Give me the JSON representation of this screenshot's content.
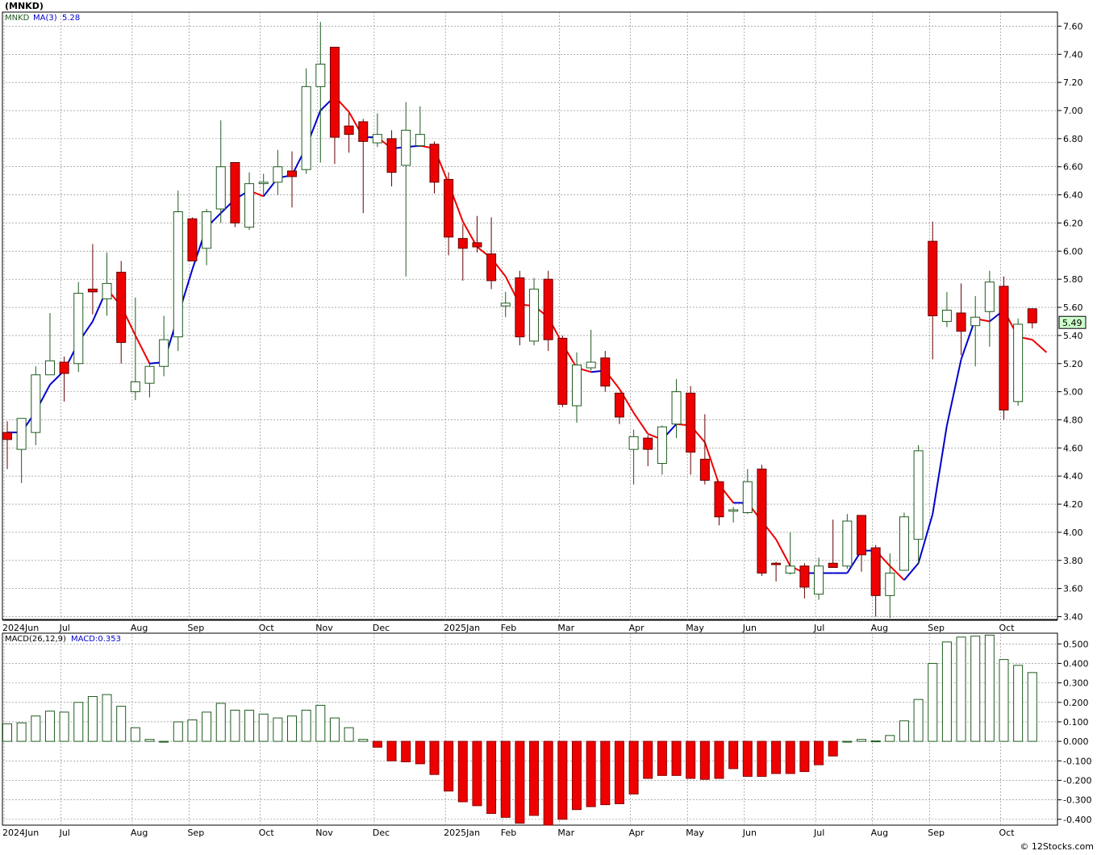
{
  "header": {
    "symbol_title": "(MNKD)",
    "footer": "© 12Stocks.com"
  },
  "colors": {
    "grid": "#7f7f7f",
    "up_edge": "#1f5c1f",
    "down_fill": "#ee0000",
    "down_edge": "#660000",
    "ma_up": "#0000cc",
    "ma_down": "#ee0000",
    "macd_pos_edge": "#1f5c1f",
    "macd_neg_fill": "#ee0000",
    "symbol_text": "#1f5c1f",
    "ma_text": "#0000cc",
    "last_label_bg": "#ccffcc"
  },
  "chart_data": [
    {
      "type": "candlestick",
      "legend": {
        "symbol": "MNKD",
        "ma_label": "MA(3)",
        "ma_value": "5.28"
      },
      "last_price_label": "5.49",
      "last_price": 5.49,
      "ylim": [
        3.38,
        7.7
      ],
      "y_ticks": [
        "7.60",
        "7.40",
        "7.20",
        "7.00",
        "6.80",
        "6.60",
        "6.40",
        "6.20",
        "6.00",
        "5.80",
        "5.60",
        "5.40",
        "5.20",
        "5.00",
        "4.80",
        "4.60",
        "4.40",
        "4.20",
        "4.00",
        "3.80",
        "3.60",
        "3.40"
      ],
      "x_labels": [
        {
          "label": "2024Jun",
          "index": 0
        },
        {
          "label": "Jul",
          "index": 4
        },
        {
          "label": "Aug",
          "index": 9
        },
        {
          "label": "Sep",
          "index": 13
        },
        {
          "label": "Oct",
          "index": 18
        },
        {
          "label": "Nov",
          "index": 22
        },
        {
          "label": "Dec",
          "index": 26
        },
        {
          "label": "2025Jan",
          "index": 31
        },
        {
          "label": "Feb",
          "index": 35
        },
        {
          "label": "Mar",
          "index": 39
        },
        {
          "label": "Apr",
          "index": 44
        },
        {
          "label": "May",
          "index": 48
        },
        {
          "label": "Jun",
          "index": 52
        },
        {
          "label": "Jul",
          "index": 57
        },
        {
          "label": "Aug",
          "index": 61
        },
        {
          "label": "Sep",
          "index": 65
        },
        {
          "label": "Oct",
          "index": 70
        }
      ],
      "candles": [
        {
          "o": 4.71,
          "h": 4.79,
          "l": 4.45,
          "c": 4.66
        },
        {
          "o": 4.59,
          "h": 4.81,
          "l": 4.35,
          "c": 4.81
        },
        {
          "o": 4.71,
          "h": 5.18,
          "l": 4.62,
          "c": 5.12
        },
        {
          "o": 5.12,
          "h": 5.56,
          "l": 5.12,
          "c": 5.22
        },
        {
          "o": 5.21,
          "h": 5.25,
          "l": 4.93,
          "c": 5.13
        },
        {
          "o": 5.2,
          "h": 5.78,
          "l": 5.14,
          "c": 5.7
        },
        {
          "o": 5.73,
          "h": 6.05,
          "l": 5.55,
          "c": 5.71
        },
        {
          "o": 5.66,
          "h": 5.99,
          "l": 5.54,
          "c": 5.77
        },
        {
          "o": 5.85,
          "h": 5.93,
          "l": 5.2,
          "c": 5.35
        },
        {
          "o": 5.0,
          "h": 5.67,
          "l": 4.94,
          "c": 5.07
        },
        {
          "o": 5.06,
          "h": 5.2,
          "l": 4.96,
          "c": 5.18
        },
        {
          "o": 5.18,
          "h": 5.54,
          "l": 5.11,
          "c": 5.37
        },
        {
          "o": 5.39,
          "h": 6.43,
          "l": 5.29,
          "c": 6.28
        },
        {
          "o": 6.23,
          "h": 6.24,
          "l": 5.95,
          "c": 5.93
        },
        {
          "o": 6.02,
          "h": 6.3,
          "l": 5.9,
          "c": 6.28
        },
        {
          "o": 6.3,
          "h": 6.93,
          "l": 6.2,
          "c": 6.6
        },
        {
          "o": 6.63,
          "h": 6.63,
          "l": 6.17,
          "c": 6.2
        },
        {
          "o": 6.17,
          "h": 6.56,
          "l": 6.15,
          "c": 6.48
        },
        {
          "o": 6.48,
          "h": 6.55,
          "l": 6.4,
          "c": 6.49
        },
        {
          "o": 6.49,
          "h": 6.72,
          "l": 6.4,
          "c": 6.6
        },
        {
          "o": 6.57,
          "h": 6.71,
          "l": 6.31,
          "c": 6.53
        },
        {
          "o": 6.58,
          "h": 7.3,
          "l": 6.55,
          "c": 7.17
        },
        {
          "o": 7.17,
          "h": 7.63,
          "l": 6.63,
          "c": 7.33
        },
        {
          "o": 7.45,
          "h": 7.45,
          "l": 6.62,
          "c": 6.81
        },
        {
          "o": 6.89,
          "h": 6.98,
          "l": 6.7,
          "c": 6.83
        },
        {
          "o": 6.92,
          "h": 6.94,
          "l": 6.27,
          "c": 6.78
        },
        {
          "o": 6.77,
          "h": 6.98,
          "l": 6.74,
          "c": 6.83
        },
        {
          "o": 6.8,
          "h": 6.86,
          "l": 6.46,
          "c": 6.56
        },
        {
          "o": 6.61,
          "h": 7.06,
          "l": 5.82,
          "c": 6.86
        },
        {
          "o": 6.75,
          "h": 7.03,
          "l": 6.74,
          "c": 6.83
        },
        {
          "o": 6.76,
          "h": 6.78,
          "l": 6.41,
          "c": 6.49
        },
        {
          "o": 6.51,
          "h": 6.56,
          "l": 5.97,
          "c": 6.1
        },
        {
          "o": 6.09,
          "h": 6.19,
          "l": 5.79,
          "c": 6.02
        },
        {
          "o": 6.06,
          "h": 6.25,
          "l": 5.99,
          "c": 6.03
        },
        {
          "o": 5.98,
          "h": 6.24,
          "l": 5.73,
          "c": 5.79
        },
        {
          "o": 5.61,
          "h": 5.71,
          "l": 5.53,
          "c": 5.63
        },
        {
          "o": 5.81,
          "h": 5.86,
          "l": 5.33,
          "c": 5.39
        },
        {
          "o": 5.36,
          "h": 5.81,
          "l": 5.33,
          "c": 5.73
        },
        {
          "o": 5.8,
          "h": 5.86,
          "l": 5.29,
          "c": 5.37
        },
        {
          "o": 5.38,
          "h": 5.4,
          "l": 4.89,
          "c": 4.91
        },
        {
          "o": 4.9,
          "h": 5.28,
          "l": 4.78,
          "c": 5.19
        },
        {
          "o": 5.17,
          "h": 5.44,
          "l": 5.15,
          "c": 5.21
        },
        {
          "o": 5.24,
          "h": 5.29,
          "l": 5.0,
          "c": 5.04
        },
        {
          "o": 4.99,
          "h": 4.98,
          "l": 4.77,
          "c": 4.82
        },
        {
          "o": 4.59,
          "h": 4.73,
          "l": 4.34,
          "c": 4.68
        },
        {
          "o": 4.67,
          "h": 4.69,
          "l": 4.47,
          "c": 4.59
        },
        {
          "o": 4.49,
          "h": 4.76,
          "l": 4.41,
          "c": 4.75
        },
        {
          "o": 4.77,
          "h": 5.09,
          "l": 4.67,
          "c": 5.0
        },
        {
          "o": 4.99,
          "h": 5.04,
          "l": 4.41,
          "c": 4.57
        },
        {
          "o": 4.52,
          "h": 4.84,
          "l": 4.34,
          "c": 4.37
        },
        {
          "o": 4.36,
          "h": 4.36,
          "l": 4.05,
          "c": 4.11
        },
        {
          "o": 4.15,
          "h": 4.18,
          "l": 4.07,
          "c": 4.16
        },
        {
          "o": 4.14,
          "h": 4.45,
          "l": 4.13,
          "c": 4.36
        },
        {
          "o": 4.45,
          "h": 4.48,
          "l": 3.69,
          "c": 3.71
        },
        {
          "o": 3.78,
          "h": 3.79,
          "l": 3.65,
          "c": 3.77
        },
        {
          "o": 3.71,
          "h": 4.0,
          "l": 3.7,
          "c": 3.76
        },
        {
          "o": 3.76,
          "h": 3.78,
          "l": 3.53,
          "c": 3.61
        },
        {
          "o": 3.56,
          "h": 3.82,
          "l": 3.52,
          "c": 3.76
        },
        {
          "o": 3.78,
          "h": 4.09,
          "l": 3.77,
          "c": 3.75
        },
        {
          "o": 3.76,
          "h": 4.13,
          "l": 3.74,
          "c": 4.08
        },
        {
          "o": 4.12,
          "h": 4.12,
          "l": 3.72,
          "c": 3.84
        },
        {
          "o": 3.89,
          "h": 3.91,
          "l": 3.4,
          "c": 3.55
        },
        {
          "o": 3.55,
          "h": 3.85,
          "l": 3.39,
          "c": 3.71
        },
        {
          "o": 3.73,
          "h": 4.14,
          "l": 3.73,
          "c": 4.11
        },
        {
          "o": 3.95,
          "h": 4.62,
          "l": 3.77,
          "c": 4.58
        },
        {
          "o": 6.07,
          "h": 6.21,
          "l": 5.23,
          "c": 5.54
        },
        {
          "o": 5.5,
          "h": 5.71,
          "l": 5.46,
          "c": 5.58
        },
        {
          "o": 5.56,
          "h": 5.77,
          "l": 5.26,
          "c": 5.43
        },
        {
          "o": 5.47,
          "h": 5.68,
          "l": 5.18,
          "c": 5.53
        },
        {
          "o": 5.57,
          "h": 5.86,
          "l": 5.32,
          "c": 5.78
        },
        {
          "o": 5.75,
          "h": 5.82,
          "l": 4.8,
          "c": 4.87
        },
        {
          "o": 4.93,
          "h": 5.52,
          "l": 4.9,
          "c": 5.48
        },
        {
          "o": 5.59,
          "h": 5.57,
          "l": 5.45,
          "c": 5.49
        }
      ],
      "ma3": [
        4.71,
        4.71,
        4.86,
        5.05,
        5.15,
        5.35,
        5.5,
        5.73,
        5.61,
        5.4,
        5.2,
        5.21,
        5.54,
        5.87,
        6.17,
        6.27,
        6.37,
        6.43,
        6.39,
        6.52,
        6.54,
        6.74,
        7.0,
        7.1,
        6.99,
        6.81,
        6.81,
        6.73,
        6.74,
        6.75,
        6.73,
        6.48,
        6.21,
        6.03,
        5.95,
        5.82,
        5.62,
        5.61,
        5.53,
        5.34,
        5.17,
        5.14,
        5.15,
        5.02,
        4.85,
        4.7,
        4.66,
        4.77,
        4.76,
        4.64,
        4.34,
        4.21,
        4.21,
        4.08,
        3.95,
        3.76,
        3.71,
        3.71,
        3.71,
        3.71,
        3.87,
        3.87,
        3.76,
        3.66,
        3.78,
        4.13,
        4.76,
        5.23,
        5.52,
        5.5,
        5.58,
        5.39,
        5.37,
        5.28
      ]
    },
    {
      "type": "bar",
      "legend": {
        "name": "MACD(26,12,9)",
        "value_label": "MACD:0.353"
      },
      "ylim": [
        -0.43,
        0.555
      ],
      "y_ticks": [
        "0.500",
        "0.400",
        "0.300",
        "0.200",
        "0.100",
        "0.000",
        "-0.100",
        "-0.200",
        "-0.300",
        "-0.400"
      ],
      "x_labels": [
        {
          "label": "2024Jun",
          "index": 0
        },
        {
          "label": "Jul",
          "index": 4
        },
        {
          "label": "Aug",
          "index": 9
        },
        {
          "label": "Sep",
          "index": 13
        },
        {
          "label": "Oct",
          "index": 18
        },
        {
          "label": "Nov",
          "index": 22
        },
        {
          "label": "Dec",
          "index": 26
        },
        {
          "label": "2025Jan",
          "index": 31
        },
        {
          "label": "Feb",
          "index": 35
        },
        {
          "label": "Mar",
          "index": 39
        },
        {
          "label": "Apr",
          "index": 44
        },
        {
          "label": "May",
          "index": 48
        },
        {
          "label": "Jun",
          "index": 52
        },
        {
          "label": "Jul",
          "index": 57
        },
        {
          "label": "Aug",
          "index": 61
        },
        {
          "label": "Sep",
          "index": 65
        },
        {
          "label": "Oct",
          "index": 70
        }
      ],
      "values": [
        0.09,
        0.095,
        0.13,
        0.155,
        0.15,
        0.2,
        0.23,
        0.24,
        0.18,
        0.07,
        0.01,
        0.0,
        0.1,
        0.11,
        0.15,
        0.195,
        0.16,
        0.16,
        0.14,
        0.12,
        0.13,
        0.16,
        0.185,
        0.12,
        0.07,
        0.01,
        -0.03,
        -0.1,
        -0.105,
        -0.115,
        -0.17,
        -0.255,
        -0.31,
        -0.33,
        -0.37,
        -0.39,
        -0.42,
        -0.38,
        -0.43,
        -0.4,
        -0.35,
        -0.335,
        -0.325,
        -0.32,
        -0.27,
        -0.19,
        -0.175,
        -0.175,
        -0.19,
        -0.195,
        -0.19,
        -0.14,
        -0.18,
        -0.18,
        -0.165,
        -0.165,
        -0.155,
        -0.12,
        -0.075,
        0.0,
        0.01,
        0.002,
        0.03,
        0.105,
        0.215,
        0.4,
        0.51,
        0.535,
        0.54,
        0.545,
        0.42,
        0.39,
        0.353
      ]
    }
  ]
}
